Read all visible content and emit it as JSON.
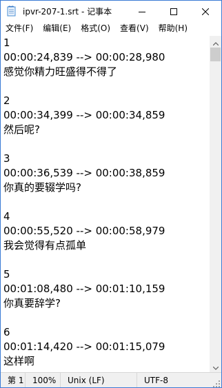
{
  "window": {
    "title": "ipvr-207-1.srt - 记事本",
    "minimize_icon": "minimize-icon",
    "maximize_icon": "maximize-icon",
    "close_icon": "close-icon"
  },
  "menu": {
    "items": [
      {
        "label": "文件(F)"
      },
      {
        "label": "编辑(E)"
      },
      {
        "label": "格式(O)"
      },
      {
        "label": "查看(V)"
      },
      {
        "label": "帮助(H)"
      }
    ]
  },
  "document": {
    "lines": [
      "1",
      "00:00:24,839 --> 00:00:28,980",
      "感觉你精力旺盛得不得了",
      "",
      "2",
      "00:00:34,399 --> 00:00:34,859",
      "然后呢?",
      "",
      "3",
      "00:00:36,539 --> 00:00:38,859",
      "你真的要辍学吗?",
      "",
      "4",
      "00:00:55,520 --> 00:00:58,979",
      "我会觉得有点孤单",
      "",
      "5",
      "00:01:08,480 --> 00:01:10,159",
      "你真要辞学?",
      "",
      "6",
      "00:01:14,420 --> 00:01:15,079",
      "这样啊",
      ""
    ]
  },
  "status": {
    "position": "第 1",
    "zoom": "100%",
    "line_ending": "Unix (LF)",
    "encoding": "UTF-8"
  },
  "colors": {
    "window_border": "#3a7bd5",
    "statusbar_bg": "#f0f0f0"
  }
}
